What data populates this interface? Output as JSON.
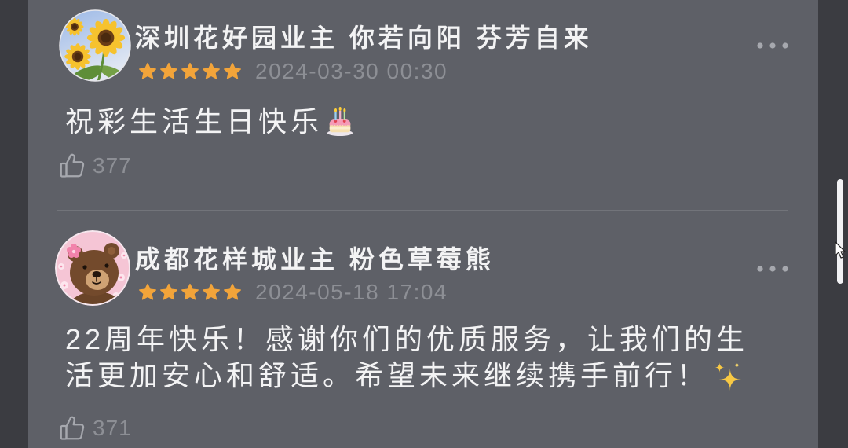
{
  "comments": [
    {
      "avatar_icon": "sunflower-avatar",
      "name": "深圳花好园业主 你若向阳 芬芳自来",
      "rating": 5,
      "date": "2024-03-30 00:30",
      "content_lines": [
        "祝彩生活生日快乐"
      ],
      "emoji_icon": "birthday-cake-emoji",
      "likes": "377"
    },
    {
      "avatar_icon": "brown-bear-avatar",
      "name": "成都花样城业主 粉色草莓熊",
      "rating": 5,
      "date": "2024-05-18 17:04",
      "content_lines": [
        "22周年快乐！感谢你们的优质服务，让我们的生",
        "活更加安心和舒适。希望未来继续携手前行！"
      ],
      "emoji_icon": "sparkles-emoji",
      "likes": "371"
    }
  ],
  "icons": {
    "more": "more-dots-icon",
    "like": "thumbs-up-icon",
    "star": "star-icon",
    "cursor": "mouse-pointer-icon"
  },
  "colors": {
    "panel_bg": "#5e6067",
    "side_bg": "#3b3c41",
    "text": "#f3f3f4",
    "meta": "#8d8f95",
    "star": "#f2a43a",
    "icon": "#a6a8ae"
  }
}
